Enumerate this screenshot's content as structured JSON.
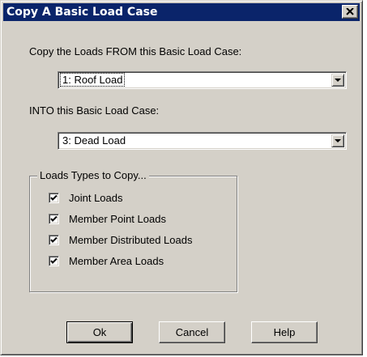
{
  "dialog": {
    "title": "Copy A Basic Load Case",
    "close_icon": "close-icon",
    "from_label": "Copy the Loads FROM this Basic Load Case:",
    "from_value": "1: Roof Load",
    "into_label": "INTO this Basic Load Case:",
    "into_value": "3: Dead Load",
    "group_label": "Loads Types to Copy...",
    "load_types": [
      {
        "label": "Joint Loads",
        "checked": true
      },
      {
        "label": "Member Point Loads",
        "checked": true
      },
      {
        "label": "Member Distributed Loads",
        "checked": true
      },
      {
        "label": "Member Area Loads",
        "checked": true
      }
    ],
    "buttons": {
      "ok": "Ok",
      "cancel": "Cancel",
      "help": "Help"
    }
  },
  "colors": {
    "titlebar": "#0a246a",
    "face": "#d4d0c8"
  }
}
